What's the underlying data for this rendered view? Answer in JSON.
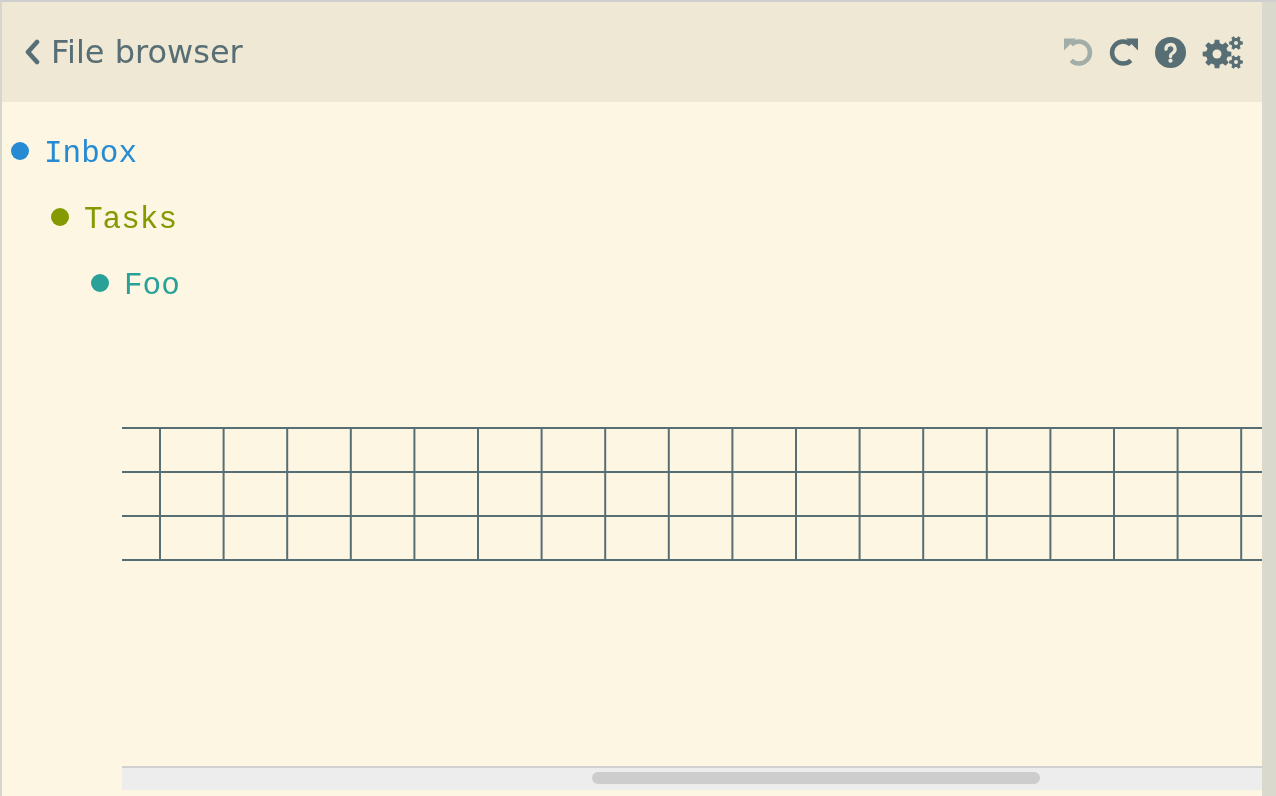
{
  "header": {
    "title": "File browser",
    "toolbar": [
      {
        "kind": "undo",
        "disabled": true
      },
      {
        "kind": "redo",
        "disabled": false
      },
      {
        "kind": "help",
        "disabled": false
      },
      {
        "kind": "settings",
        "disabled": false
      }
    ]
  },
  "tree": [
    {
      "label": "Inbox",
      "color": "#268bd2",
      "children": [
        {
          "label": "Tasks",
          "color": "#859900",
          "children": [
            {
              "label": "Foo",
              "color": "#2aa198"
            }
          ]
        }
      ]
    }
  ]
}
